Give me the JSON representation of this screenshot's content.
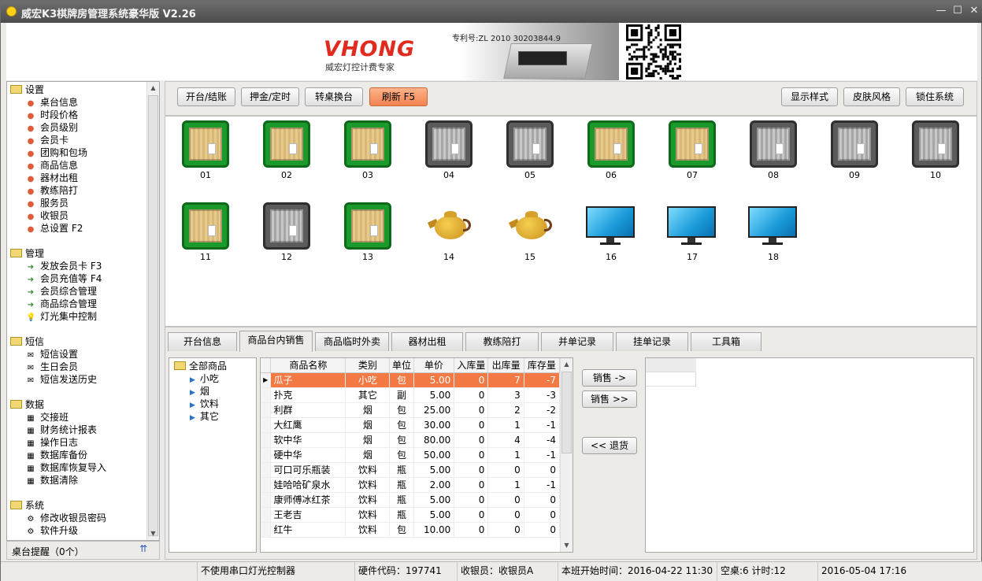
{
  "window": {
    "title": "威宏K3棋牌房管理系统豪华版 V2.26"
  },
  "banner": {
    "logo": "VHONG",
    "slogan": "威宏灯控计费专家",
    "patent": "专利号:ZL 2010 30203844.9"
  },
  "nav": {
    "groups": [
      {
        "label": "设置",
        "items": [
          "桌台信息",
          "时段价格",
          "会员级别",
          "会员卡",
          "团购和包场",
          "商品信息",
          "器材出租",
          "教练陪打",
          "服务员",
          "收银员",
          "总设置 F2"
        ]
      },
      {
        "label": "管理",
        "items": [
          "发放会员卡 F3",
          "会员充值等 F4",
          "会员综合管理",
          "商品综合管理",
          "灯光集中控制"
        ]
      },
      {
        "label": "短信",
        "items": [
          "短信设置",
          "生日会员",
          "短信发送历史"
        ]
      },
      {
        "label": "数据",
        "items": [
          "交接班",
          "财务统计报表",
          "操作日志",
          "数据库备份",
          "数据库恢复导入",
          "数据清除"
        ]
      },
      {
        "label": "系统",
        "items": [
          "修改收银员密码",
          "软件升级"
        ]
      }
    ],
    "footer": "桌台提醒（0个）"
  },
  "toolbar": {
    "left": [
      "开台/结账",
      "押金/定时",
      "转桌换台",
      "刷新 F5"
    ],
    "right": [
      "显示样式",
      "皮肤风格",
      "锁住系统"
    ]
  },
  "tables": [
    {
      "id": "01",
      "kind": "mahjong",
      "status": "on"
    },
    {
      "id": "02",
      "kind": "mahjong",
      "status": "on"
    },
    {
      "id": "03",
      "kind": "mahjong",
      "status": "on"
    },
    {
      "id": "04",
      "kind": "mahjong",
      "status": "off"
    },
    {
      "id": "05",
      "kind": "mahjong",
      "status": "off"
    },
    {
      "id": "06",
      "kind": "mahjong",
      "status": "on"
    },
    {
      "id": "07",
      "kind": "mahjong",
      "status": "on"
    },
    {
      "id": "08",
      "kind": "mahjong",
      "status": "off"
    },
    {
      "id": "09",
      "kind": "mahjong",
      "status": "off"
    },
    {
      "id": "10",
      "kind": "mahjong",
      "status": "off"
    },
    {
      "id": "11",
      "kind": "mahjong",
      "status": "on"
    },
    {
      "id": "12",
      "kind": "mahjong",
      "status": "off"
    },
    {
      "id": "13",
      "kind": "mahjong",
      "status": "on"
    },
    {
      "id": "14",
      "kind": "teapot",
      "status": "off"
    },
    {
      "id": "15",
      "kind": "teapot",
      "status": "off"
    },
    {
      "id": "16",
      "kind": "computer",
      "status": "off"
    },
    {
      "id": "17",
      "kind": "computer",
      "status": "off"
    },
    {
      "id": "18",
      "kind": "computer",
      "status": "off"
    }
  ],
  "tabs": [
    "开台信息",
    "商品台内销售",
    "商品临时外卖",
    "器材出租",
    "教练陪打",
    "并单记录",
    "挂单记录",
    "工具箱"
  ],
  "active_tab": 1,
  "tree": {
    "root": "全部商品",
    "children": [
      "小吃",
      "烟",
      "饮料",
      "其它"
    ]
  },
  "grid": {
    "columns": [
      "商品名称",
      "类别",
      "单位",
      "单价",
      "入库量",
      "出库量",
      "库存量"
    ],
    "rows": [
      [
        "瓜子",
        "小吃",
        "包",
        "5.00",
        "0",
        "7",
        "-7"
      ],
      [
        "扑克",
        "其它",
        "副",
        "5.00",
        "0",
        "3",
        "-3"
      ],
      [
        "利群",
        "烟",
        "包",
        "25.00",
        "0",
        "2",
        "-2"
      ],
      [
        "大红鹰",
        "烟",
        "包",
        "30.00",
        "0",
        "1",
        "-1"
      ],
      [
        "软中华",
        "烟",
        "包",
        "80.00",
        "0",
        "4",
        "-4"
      ],
      [
        "硬中华",
        "烟",
        "包",
        "50.00",
        "0",
        "1",
        "-1"
      ],
      [
        "可口可乐瓶装",
        "饮料",
        "瓶",
        "5.00",
        "0",
        "0",
        "0"
      ],
      [
        "娃哈哈矿泉水",
        "饮料",
        "瓶",
        "2.00",
        "0",
        "1",
        "-1"
      ],
      [
        "康师傅冰红茶",
        "饮料",
        "瓶",
        "5.00",
        "0",
        "0",
        "0"
      ],
      [
        "王老吉",
        "饮料",
        "瓶",
        "5.00",
        "0",
        "0",
        "0"
      ],
      [
        "红牛",
        "饮料",
        "包",
        "10.00",
        "0",
        "0",
        "0"
      ]
    ],
    "selected": 0
  },
  "actions": {
    "sell_one": "销售 ->",
    "sell_all": "销售 >>",
    "return": "<< 退货"
  },
  "status": [
    "不使用串口灯光控制器",
    "硬件代码：197741",
    "收银员：收银员A",
    "本班开始时间：2016-04-22 11:30",
    "空桌:6 计时:12",
    "2016-05-04 17:16"
  ]
}
